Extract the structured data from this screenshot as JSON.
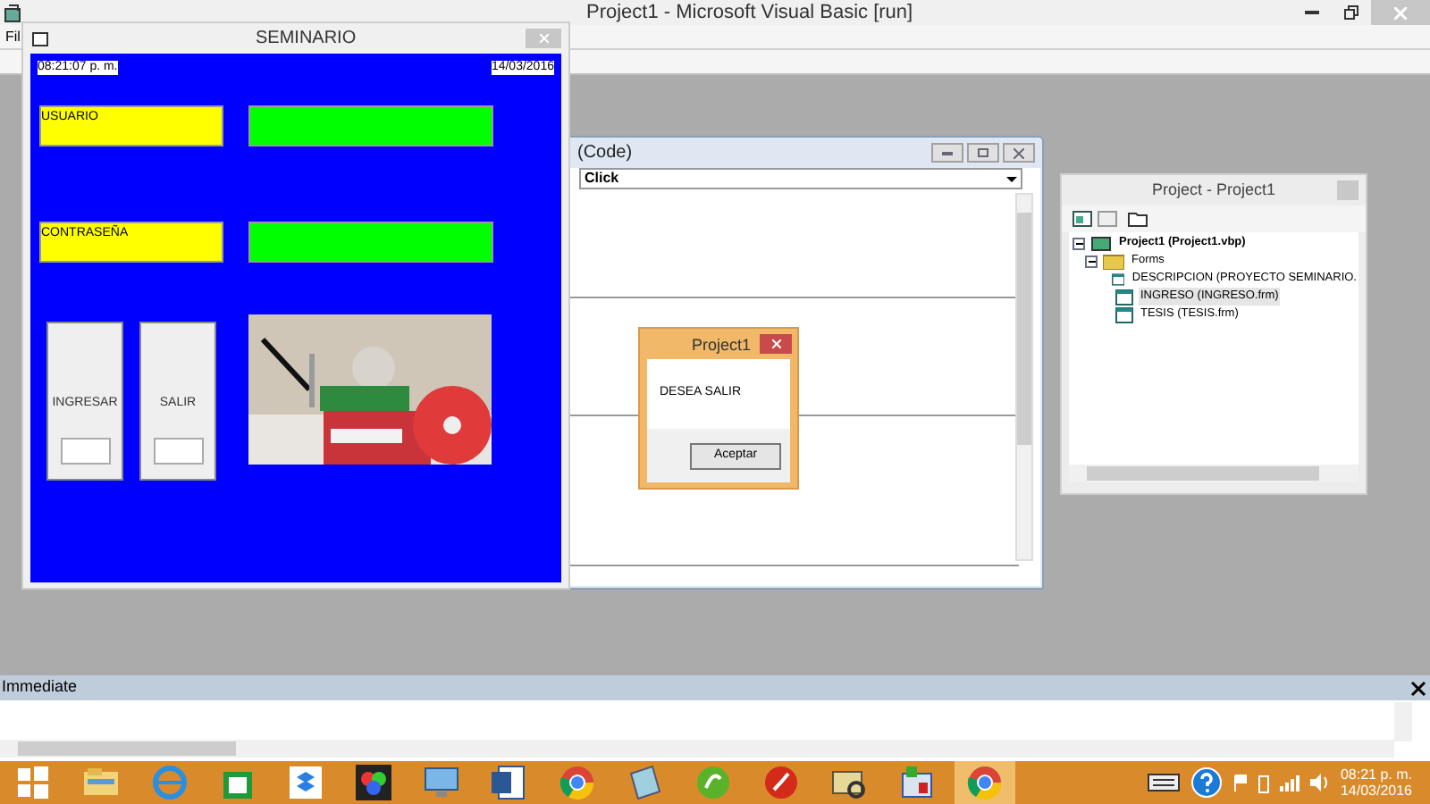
{
  "window": {
    "title": "Project1 - Microsoft Visual Basic [run]"
  },
  "menu": [
    "Fil"
  ],
  "form": {
    "title": "SEMINARIO",
    "time": "08:21:07 p. m.",
    "date": "14/03/2016",
    "labels": [
      "USUARIO",
      "CONTRASEÑA"
    ],
    "buttons": [
      "INGRESAR",
      "SALIR"
    ],
    "picture": {
      "kind": "picture"
    }
  },
  "code_window": {
    "title": "(Code)",
    "procedure": "Click"
  },
  "message_box": {
    "title": "Project1",
    "message": "DESEA SALIR",
    "button": "Aceptar"
  },
  "project_window": {
    "title": "Project - Project1",
    "tree": [
      {
        "label": "Project1 (Project1.vbp)",
        "kind": "project",
        "expanded": true,
        "selected": false,
        "children": [
          {
            "label": "Forms",
            "kind": "folder",
            "expanded": true,
            "selected": false,
            "children": [
              {
                "label": "DESCRIPCION (PROYECTO SEMINARIO.",
                "kind": "form",
                "selected": false
              },
              {
                "label": "INGRESO (INGRESO.frm)",
                "kind": "form",
                "selected": true
              },
              {
                "label": "TESIS (TESIS.frm)",
                "kind": "form",
                "selected": false
              }
            ]
          }
        ]
      }
    ]
  },
  "immediate": {
    "title": "Immediate"
  },
  "taskbar": {
    "items": [
      {
        "kind": "start",
        "selected": false
      },
      {
        "kind": "folder",
        "selected": false
      },
      {
        "kind": "browser-e",
        "selected": false
      },
      {
        "kind": "store",
        "selected": false
      },
      {
        "kind": "box",
        "selected": false
      },
      {
        "kind": "puzzle",
        "selected": false
      },
      {
        "kind": "monitor",
        "selected": false
      },
      {
        "kind": "document",
        "selected": false
      },
      {
        "kind": "chrome",
        "selected": false
      },
      {
        "kind": "notes",
        "selected": false
      },
      {
        "kind": "green-circle",
        "selected": false
      },
      {
        "kind": "red-circle",
        "selected": false
      },
      {
        "kind": "envelope",
        "selected": false
      },
      {
        "kind": "forms",
        "selected": false
      },
      {
        "kind": "chrome",
        "selected": true
      }
    ],
    "time": "08:21 p. m.",
    "date": "14/03/2016"
  }
}
